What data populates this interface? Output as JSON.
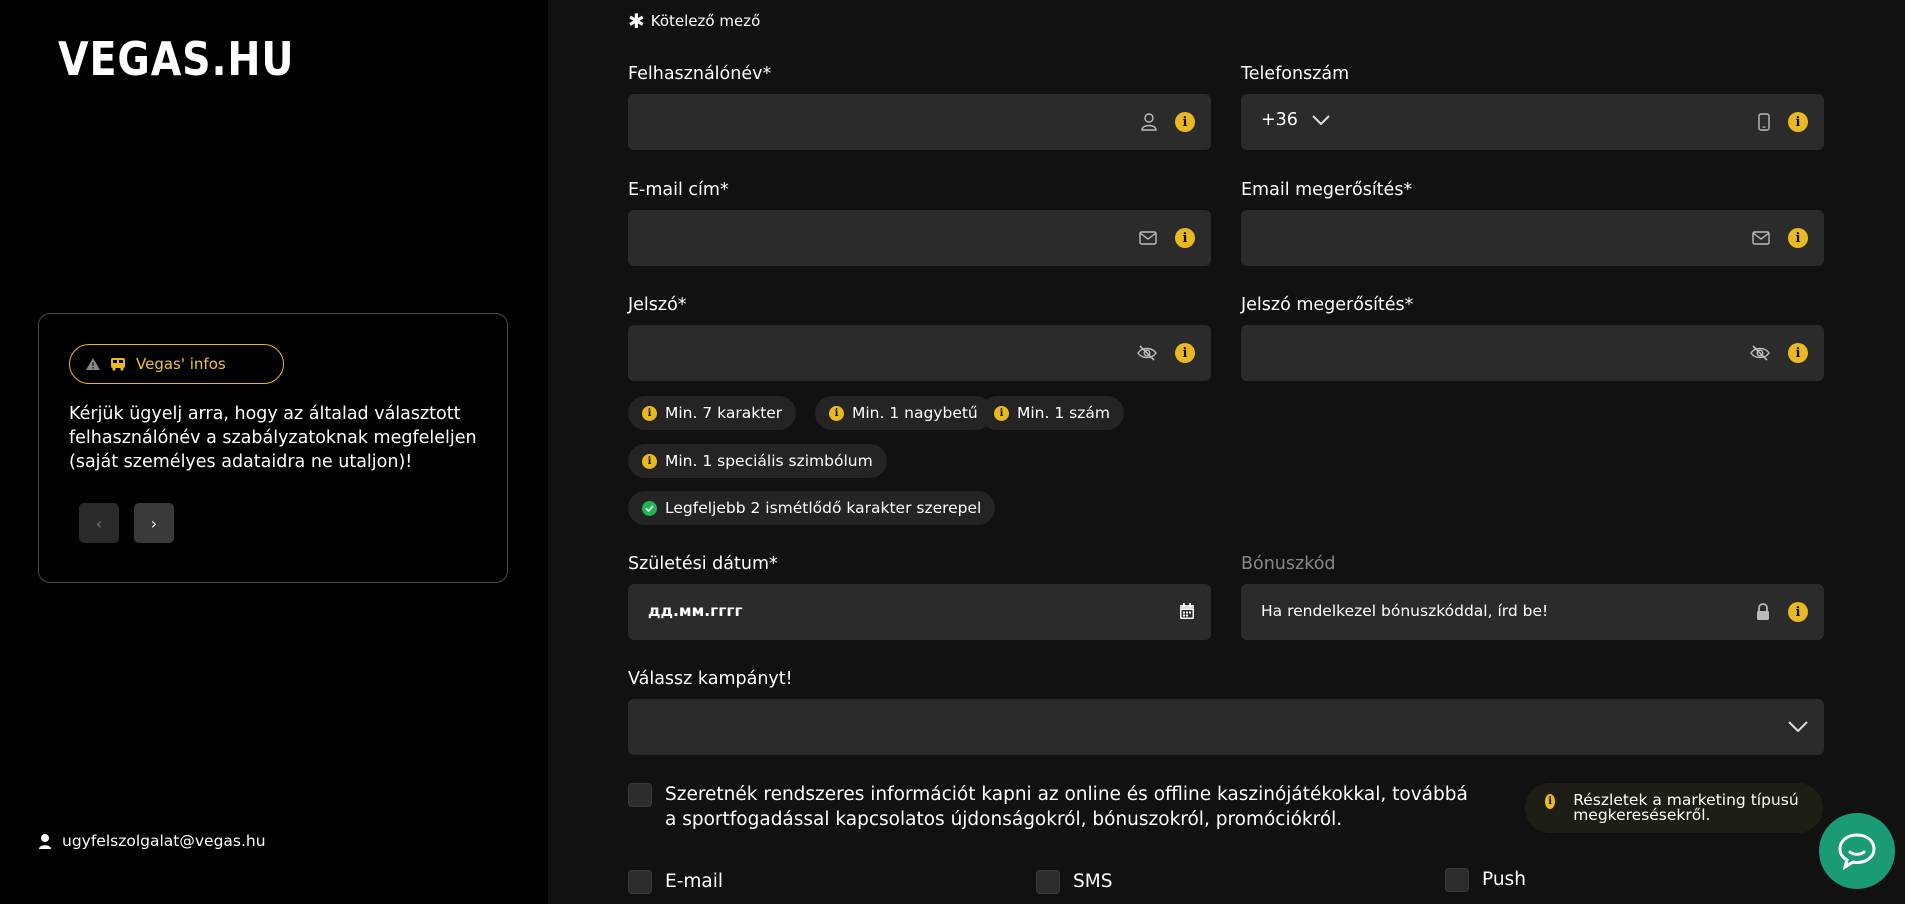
{
  "brand": {
    "logo": "VEGAS.HU",
    "accent_color": "#e8b923",
    "success_color": "#22b453"
  },
  "sidebar": {
    "info_badge": "Vegas' infos",
    "info_text": "Kérjük ügyelj arra, hogy az általad választott felhasználónév a szabályzatoknak megfeleljen (saját személyes adataidra ne utaljon)!",
    "prev_label": "‹",
    "next_label": "›",
    "support_email": "ugyfelszolgalat@vegas.hu"
  },
  "form": {
    "required_note": "Kötelező mező",
    "username": {
      "label": "Felhasználónév*",
      "value": ""
    },
    "phone": {
      "label": "Telefonszám",
      "prefix": "+36",
      "value": ""
    },
    "email": {
      "label": "E-mail cím*",
      "value": ""
    },
    "email_confirm": {
      "label": "Email megerősítés*",
      "value": ""
    },
    "password": {
      "label": "Jelszó*",
      "value": ""
    },
    "password_confirm": {
      "label": "Jelszó megerősítés*",
      "value": ""
    },
    "password_rules": [
      {
        "text": "Min. 7 karakter",
        "status": "info"
      },
      {
        "text": "Min. 1 nagybetű",
        "status": "info"
      },
      {
        "text": "Min. 1 szám",
        "status": "info"
      },
      {
        "text": "Min. 1 speciális szimbólum",
        "status": "info"
      },
      {
        "text": "Legfeljebb 2 ismétlődő karakter szerepel",
        "status": "ok"
      }
    ],
    "birthdate": {
      "label": "Születési dátum*",
      "placeholder": "дд.мм.гггг"
    },
    "bonus": {
      "label": "Bónuszkód",
      "placeholder": "Ha rendelkezel bónuszkóddal, írd be!"
    },
    "campaign": {
      "label": "Válassz kampányt!",
      "value": ""
    },
    "marketing_consent": "Szeretnék rendszeres információt kapni az online és offline kaszinójátékokkal, továbbá a sportfogadással kapcsolatos újdonságokról, bónuszokról, promóciókról.",
    "marketing_details": "Részletek a marketing típusú megkeresésekről.",
    "channels": {
      "email": "E-mail",
      "sms": "SMS",
      "push": "Push"
    }
  },
  "icons": [
    "user-icon",
    "phone-icon",
    "mail-icon",
    "eye-off-icon",
    "info-icon",
    "calendar-icon",
    "lock-icon",
    "chevron-down-icon",
    "chat-icon",
    "check-circle-icon",
    "warning-icon",
    "bus-icon",
    "support-agent-icon"
  ]
}
